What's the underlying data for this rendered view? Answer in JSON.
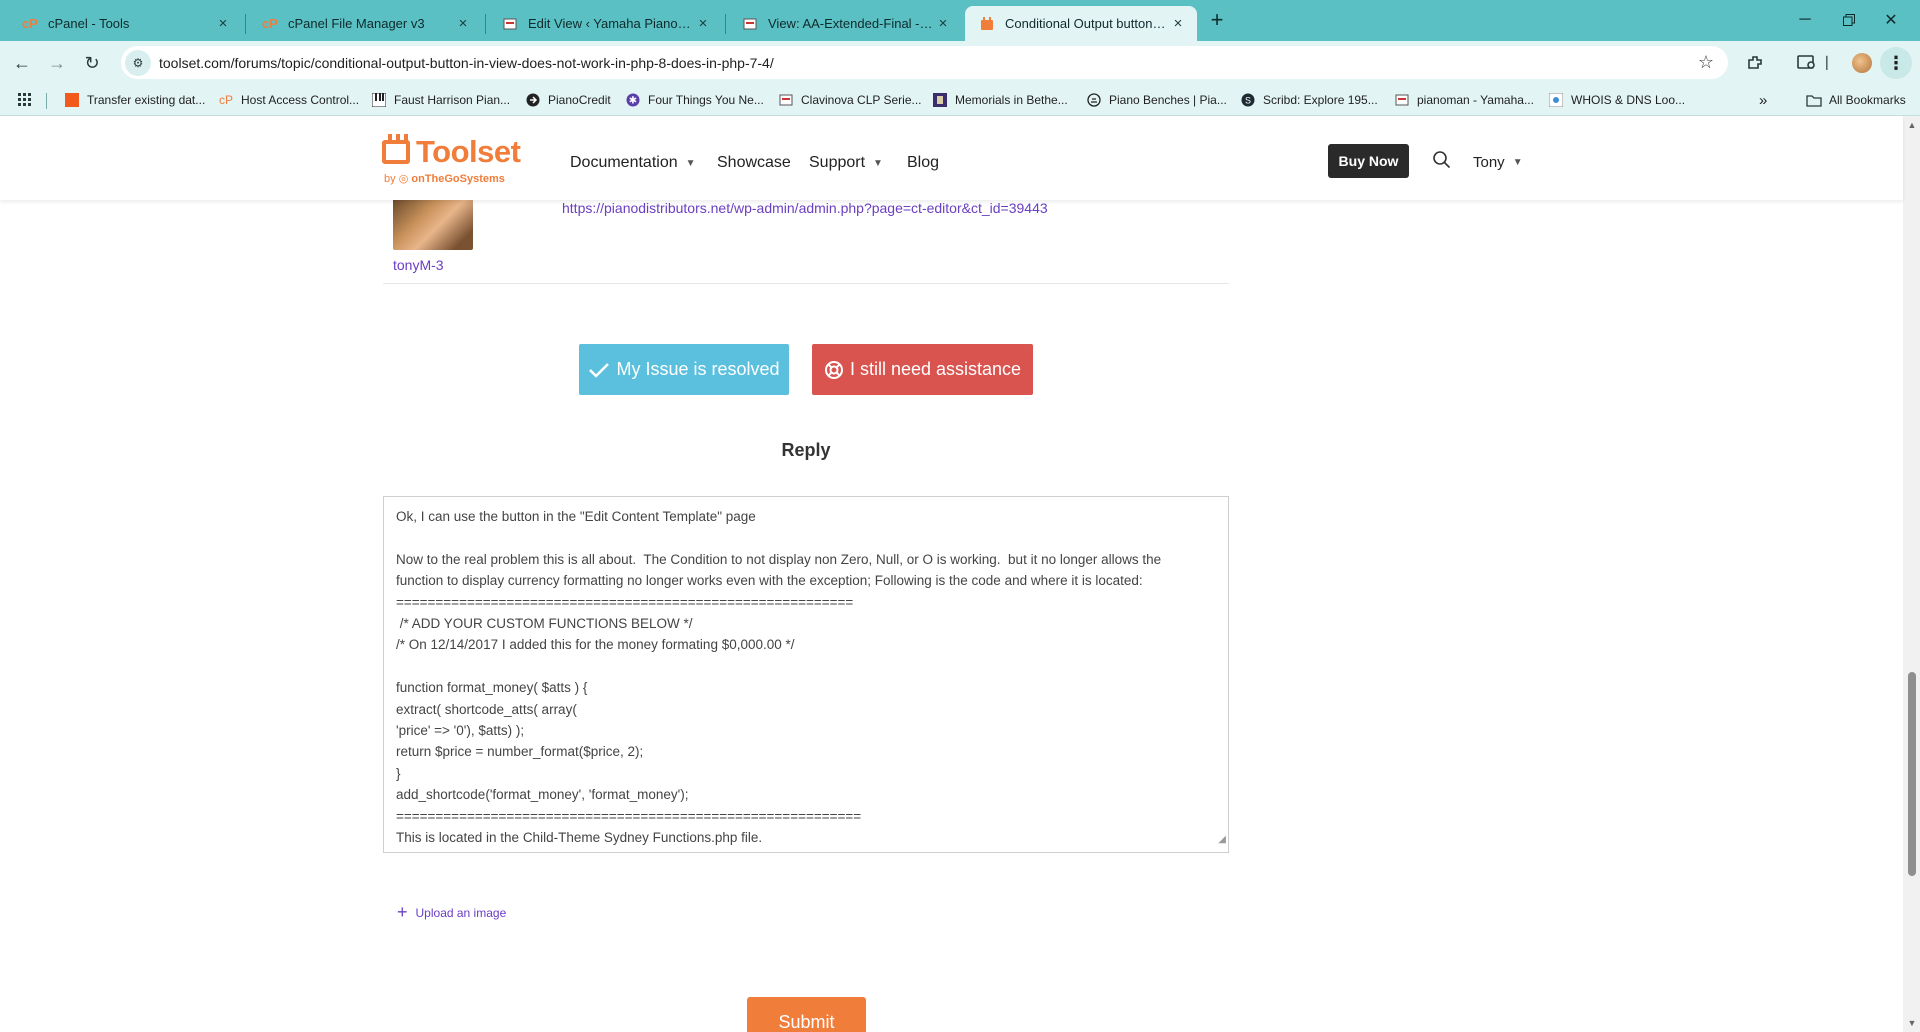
{
  "browser": {
    "tabs": [
      {
        "title": "cPanel - Tools",
        "favicon": "cpanel-icon",
        "active": false
      },
      {
        "title": "cPanel File Manager v3",
        "favicon": "cpanel-icon",
        "active": false
      },
      {
        "title": "Edit View ‹ Yamaha Pianos - Pia",
        "favicon": "site-icon",
        "active": false
      },
      {
        "title": "View: AA-Extended-Final - Yam",
        "favicon": "site-icon",
        "active": false
      },
      {
        "title": "Conditional Output button in vi",
        "favicon": "toolset-icon",
        "active": true
      }
    ],
    "url": "toolset.com/forums/topic/conditional-output-button-in-view-does-not-work-in-php-8-does-in-php-7-4/",
    "bookmarks": [
      "Transfer existing dat...",
      "Host Access Control...",
      "Faust Harrison Pian...",
      "PianoCredit",
      "Four Things You Ne...",
      "Clavinova CLP Serie...",
      "Memorials in Bethe...",
      "Piano Benches | Pia...",
      "Scribd: Explore 195...",
      "pianoman - Yamaha...",
      "WHOIS & DNS Loo..."
    ],
    "all_bookmarks": "All Bookmarks"
  },
  "header": {
    "logo_text": "Toolset",
    "logo_by": "by",
    "logo_company": "onTheGoSystems",
    "nav": [
      "Documentation",
      "Showcase",
      "Support",
      "Blog"
    ],
    "buy_now": "Buy Now",
    "user": "Tony"
  },
  "post": {
    "author": "tonyM-3",
    "link": "https://pianodistributors.net/wp-admin/admin.php?page=ct-editor&ct_id=39443"
  },
  "actions": {
    "resolved": "My Issue is resolved",
    "assist": "I still need assistance"
  },
  "reply": {
    "heading": "Reply",
    "lines": [
      "Ok, I can use the button in the \"Edit Content Template\" page",
      "",
      "Now to the real problem this is all about.  The Condition to not display non Zero, Null, or O is working.  but it no longer allows the",
      "function to display currency formatting no longer works even with the exception; Following is the code and where it is located:",
      "==========================================================",
      " /* ADD YOUR CUSTOM FUNCTIONS BELOW */",
      "/* On 12/14/2017 I added this for the money formating $0,000.00 */",
      "",
      "function format_money( $atts ) {",
      "extract( shortcode_atts( array(",
      "'price' => '0'), $atts) );",
      "return $price = number_format($price, 2);",
      "}",
      "add_shortcode('format_money', 'format_money');",
      "===========================================================",
      "This is located in the Child-Theme Sydney Functions.php file."
    ],
    "upload": "Upload an image",
    "submit": "Submit"
  },
  "colors": {
    "tab_strip": "#5bc0c3",
    "toolbar": "#e3f4f4",
    "brand": "#f07d3a",
    "link": "#6a3fc2",
    "resolved": "#5bc0de",
    "assist": "#d9534f"
  }
}
